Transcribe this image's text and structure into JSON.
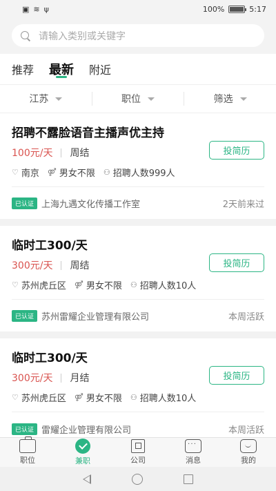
{
  "status_bar": {
    "battery": "100%",
    "time": "5:17"
  },
  "search": {
    "placeholder": "请输入类别或关键字"
  },
  "tabs": [
    {
      "label": "推荐"
    },
    {
      "label": "最新"
    },
    {
      "label": "附近"
    }
  ],
  "filters": [
    {
      "label": "江苏"
    },
    {
      "label": "职位"
    },
    {
      "label": "筛选"
    }
  ],
  "jobs": [
    {
      "title": "招聘不露脸语音主播声优主持",
      "salary": "100元/天",
      "settlement": "周结",
      "apply": "投简历",
      "location": "南京",
      "gender": "男女不限",
      "headcount": "招聘人数999人",
      "badge": "已认证",
      "company": "上海九遇文化传播工作室",
      "activity": "2天前来过"
    },
    {
      "title": "临时工300/天",
      "salary": "300元/天",
      "settlement": "周结",
      "apply": "投简历",
      "location": "苏州虎丘区",
      "gender": "男女不限",
      "headcount": "招聘人数10人",
      "badge": "已认证",
      "company": "苏州雷耀企业管理有限公司",
      "activity": "本周活跃"
    },
    {
      "title": "临时工300/天",
      "salary": "300元/天",
      "settlement": "月结",
      "apply": "投简历",
      "location": "苏州虎丘区",
      "gender": "男女不限",
      "headcount": "招聘人数10人",
      "badge": "已认证",
      "company": "雷耀企业管理有限公司",
      "activity": "本周活跃"
    }
  ],
  "bottom_nav": [
    {
      "label": "职位",
      "icon": "briefcase-icon"
    },
    {
      "label": "兼职",
      "icon": "check-circle-icon"
    },
    {
      "label": "公司",
      "icon": "building-icon"
    },
    {
      "label": "消息",
      "icon": "chat-icon"
    },
    {
      "label": "我的",
      "icon": "smile-icon"
    }
  ],
  "colors": {
    "accent": "#2bb584",
    "salary": "#d9534f"
  }
}
